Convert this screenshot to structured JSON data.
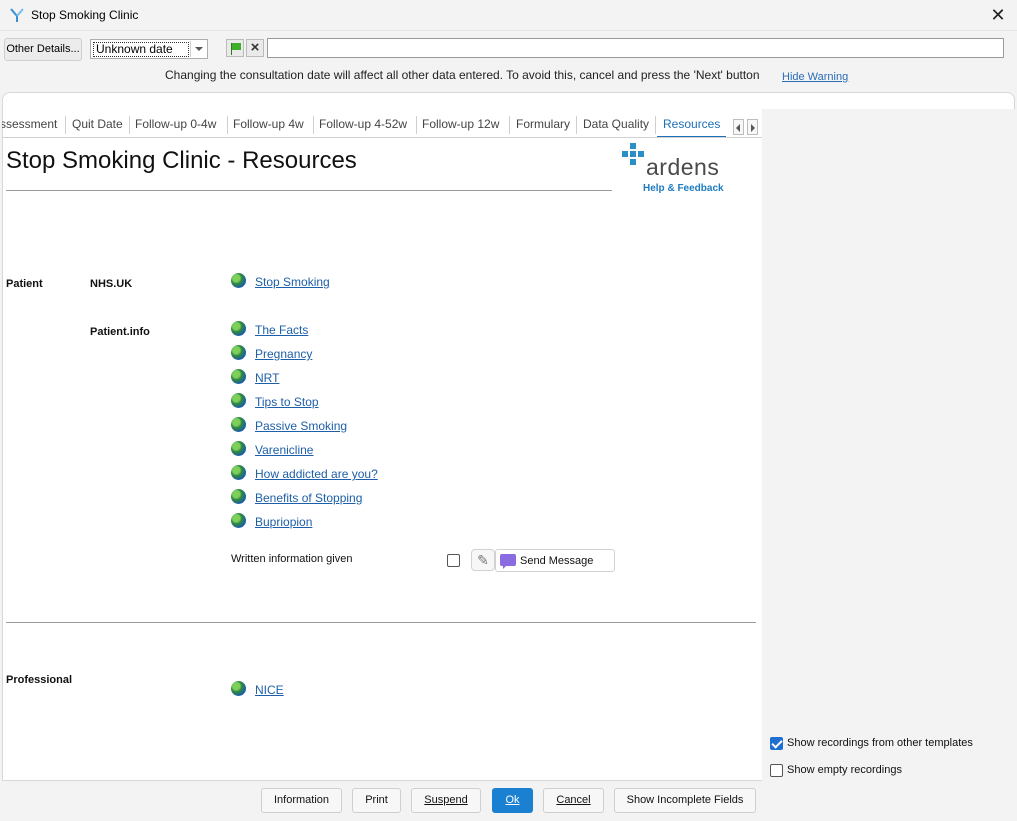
{
  "window": {
    "title": "Stop Smoking Clinic",
    "close_glyph": "✕"
  },
  "toolbar": {
    "other_details_label": "Other Details...",
    "date_value": "Unknown date",
    "notes_value": ""
  },
  "warning": {
    "message": "Changing the consultation date will affect all other data entered. To avoid this, cancel and press the 'Next' button",
    "hide_label": "Hide Warning"
  },
  "tabs": [
    {
      "label": "ssessment"
    },
    {
      "label": "Quit Date"
    },
    {
      "label": "Follow-up 0-4w"
    },
    {
      "label": "Follow-up 4w"
    },
    {
      "label": "Follow-up 4-52w"
    },
    {
      "label": "Follow-up 12w"
    },
    {
      "label": "Formulary"
    },
    {
      "label": "Data Quality"
    },
    {
      "label": "Resources",
      "active": true
    }
  ],
  "page": {
    "title": "Stop Smoking Clinic - Resources",
    "logo_text": "ardens",
    "logo_link": "Help & Feedback"
  },
  "patient": {
    "section_label": "Patient",
    "nhs_label": "NHS.UK",
    "nhs_links": [
      "Stop Smoking"
    ],
    "pinfo_label": "Patient.info",
    "pinfo_links": [
      "The Facts",
      "Pregnancy",
      "NRT",
      "Tips to Stop",
      "Passive Smoking",
      "Varenicline",
      "How addicted are you?",
      "Benefits of Stopping",
      "Bupriopion"
    ],
    "written_label": "Written information given",
    "written_checked": false,
    "send_message_label": "Send Message"
  },
  "professional": {
    "section_label": "Professional",
    "links": [
      "NICE"
    ]
  },
  "options": {
    "show_other": {
      "label": "Show recordings from other templates",
      "checked": true
    },
    "show_empty": {
      "label": "Show empty recordings",
      "checked": false
    }
  },
  "footer": {
    "information": "Information",
    "print": "Print",
    "suspend": "Suspend",
    "ok": "Ok",
    "cancel": "Cancel",
    "incomplete": "Show Incomplete Fields"
  },
  "colors": {
    "accent": "#1a80d2",
    "link": "#1d5fa8",
    "brand": "#2a8fc4"
  }
}
